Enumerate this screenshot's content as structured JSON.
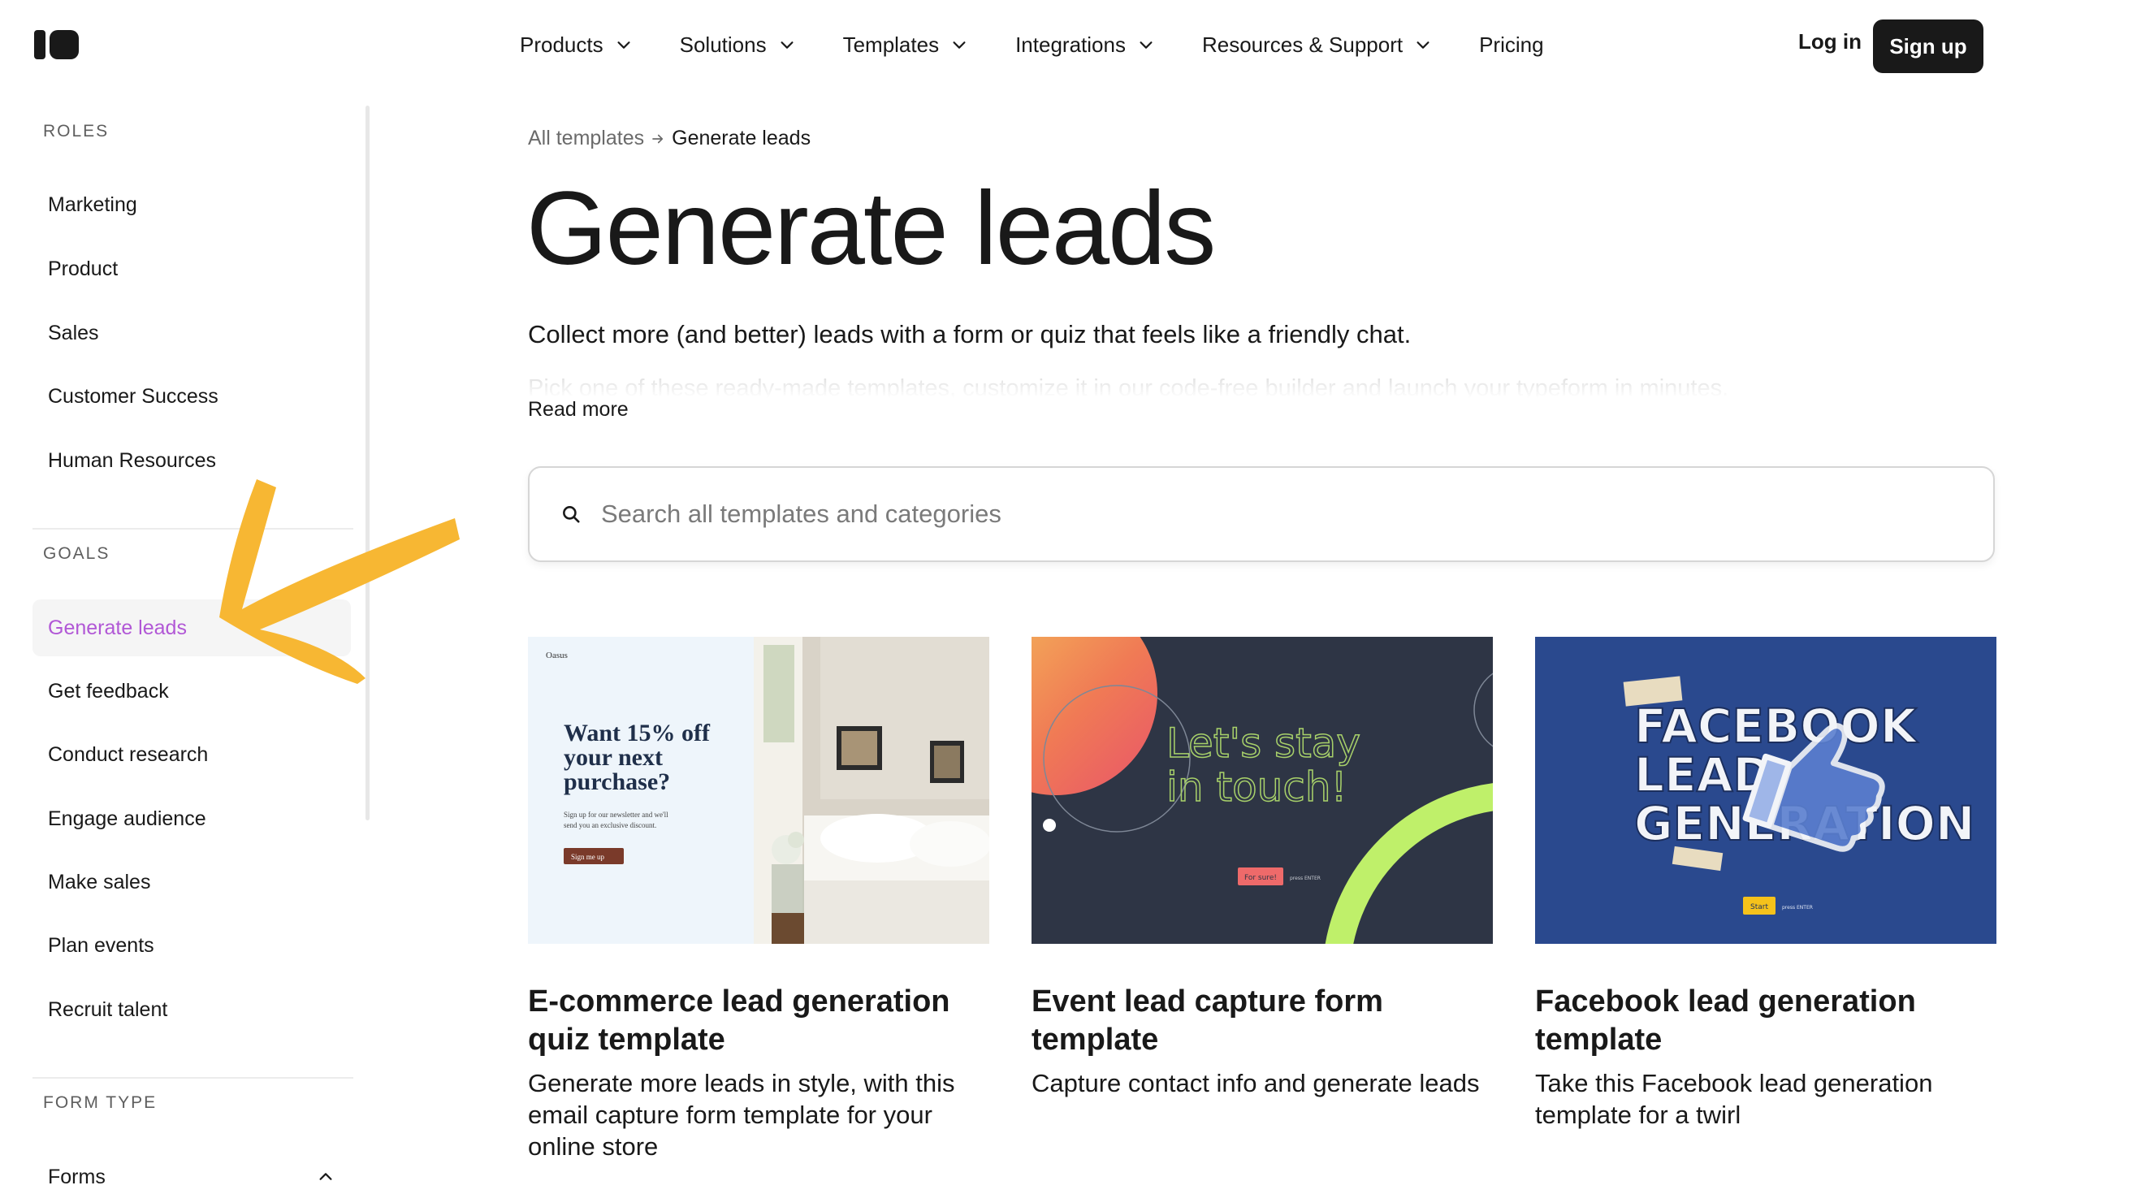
{
  "header": {
    "nav": [
      {
        "label": "Products",
        "has_dropdown": true
      },
      {
        "label": "Solutions",
        "has_dropdown": true
      },
      {
        "label": "Templates",
        "has_dropdown": true
      },
      {
        "label": "Integrations",
        "has_dropdown": true
      },
      {
        "label": "Resources & Support",
        "has_dropdown": true
      },
      {
        "label": "Pricing",
        "has_dropdown": false
      }
    ],
    "login_label": "Log in",
    "signup_label": "Sign up"
  },
  "sidebar": {
    "roles_label": "ROLES",
    "roles": [
      "Marketing",
      "Product",
      "Sales",
      "Customer Success",
      "Human Resources"
    ],
    "goals_label": "GOALS",
    "goals": [
      "Generate leads",
      "Get feedback",
      "Conduct research",
      "Engage audience",
      "Make sales",
      "Plan events",
      "Recruit talent"
    ],
    "active_goal": "Generate leads",
    "form_type_label": "FORM TYPE",
    "form_types": [
      {
        "label": "Forms",
        "expanded": true
      }
    ]
  },
  "main": {
    "breadcrumb": {
      "parent": "All templates",
      "current": "Generate leads"
    },
    "title": "Generate leads",
    "intro": "Collect more (and better) leads with a form or quiz that feels like a friendly chat.",
    "intro_truncated": "Pick one of these ready-made templates, customize it in our code-free builder and launch your typeform in minutes.",
    "read_more_label": "Read more",
    "search_placeholder": "Search all templates and categories",
    "cards": [
      {
        "title_line1": "E-commerce lead generation",
        "title_line2": "quiz template",
        "desc_lines": [
          "Generate more leads in style, with this",
          "email capture form template for your",
          "online store"
        ],
        "thumb": {
          "brand": "Oasus",
          "headline_lines": [
            "Want 15% off",
            "your next",
            "purchase?"
          ],
          "sub_lines": [
            "Sign up for our newsletter and we'll",
            "send you an exclusive discount."
          ],
          "button": "Sign me up"
        }
      },
      {
        "title_line1": "Event lead capture form",
        "title_line2": "template",
        "desc_lines": [
          "Capture contact info and generate leads"
        ],
        "thumb": {
          "headline_lines": [
            "Let's stay",
            "in touch!"
          ],
          "button": "For sure!",
          "hint": "press ENTER"
        }
      },
      {
        "title_line1": "Facebook lead generation",
        "title_line2": "template",
        "desc_lines": [
          "Take this Facebook lead generation",
          "template for a twirl"
        ],
        "thumb": {
          "headline_lines": [
            "FACEBOOK",
            "LEAD",
            "GENERATION"
          ],
          "button": "Start",
          "hint": "press ENTER"
        }
      }
    ]
  },
  "colors": {
    "accent_purple": "#b157d6",
    "arrow_yellow": "#f7b733",
    "dark": "#191919"
  }
}
